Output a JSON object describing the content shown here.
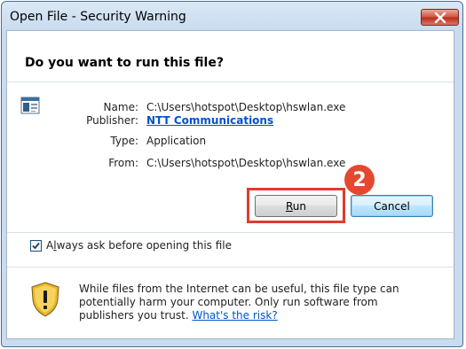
{
  "window": {
    "title": "Open File - Security Warning"
  },
  "question": "Do you want to run this file?",
  "details": {
    "name_label": "Name:",
    "name_value": "C:\\Users\\hotspot\\Desktop\\hswlan.exe",
    "publisher_label": "Publisher:",
    "publisher_value": "NTT Communications",
    "type_label": "Type:",
    "type_value": "Application",
    "from_label": "From:",
    "from_value": "C:\\Users\\hotspot\\Desktop\\hswlan.exe"
  },
  "buttons": {
    "run_pre": "",
    "run_accel": "R",
    "run_post": "un",
    "cancel": "Cancel"
  },
  "annotation": {
    "step_number": "2",
    "highlight_color": "#e03a2f"
  },
  "checkbox": {
    "checked": true,
    "label_pre": "A",
    "label_accel": "l",
    "label_post": "ways ask before opening this file"
  },
  "warning": {
    "text": "While files from the Internet can be useful, this file type can potentially harm your computer. Only run software from publishers you trust. ",
    "link": "What's the risk?"
  },
  "icons": {
    "close": "close-icon",
    "file": "application-file-icon",
    "shield": "security-shield-icon",
    "check": "checkmark-icon"
  },
  "colors": {
    "accent": "#0054c6",
    "close_button": "#c9412e"
  }
}
